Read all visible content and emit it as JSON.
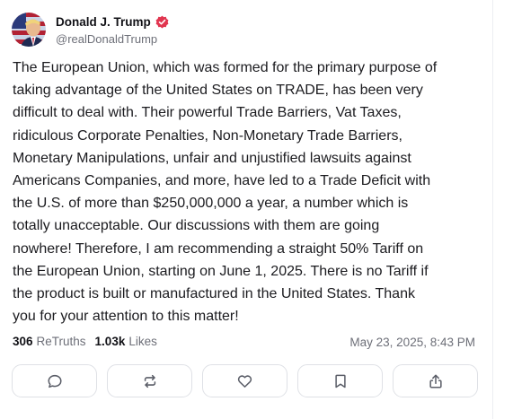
{
  "author": {
    "display_name": "Donald J. Trump",
    "handle": "@realDonaldTrump",
    "verified": true
  },
  "post": {
    "text": "The European Union, which was formed for the primary purpose of\ntaking advantage of the United States on TRADE, has been very\ndifficult to deal with. Their powerful Trade Barriers, Vat Taxes,\nridiculous Corporate Penalties, Non-Monetary Trade Barriers,\nMonetary Manipulations, unfair and unjustified lawsuits against\nAmericans Companies, and more, have led to a Trade Deficit with\nthe U.S. of more than $250,000,000 a year, a number which is\ntotally unacceptable. Our discussions with them are going\nnowhere! Therefore, I am recommending a straight 50% Tariff on\nthe European Union, starting on June 1, 2025. There is no Tariff if\nthe product is built or manufactured in the United States. Thank\nyou for your attention to this matter!"
  },
  "stats": {
    "retruths_count": "306",
    "retruths_label": "ReTruths",
    "likes_count": "1.03k",
    "likes_label": "Likes"
  },
  "timestamp": "May 23, 2025, 8:43 PM",
  "actions": [
    {
      "name": "reply",
      "icon": "speech-bubble-icon"
    },
    {
      "name": "retruth",
      "icon": "repost-arrows-icon"
    },
    {
      "name": "like",
      "icon": "heart-icon"
    },
    {
      "name": "bookmark",
      "icon": "bookmark-icon"
    },
    {
      "name": "share",
      "icon": "share-icon"
    }
  ],
  "colors": {
    "verified_badge": "#e1354f",
    "muted_text": "#6d6f78",
    "icon_stroke": "#5b5e68",
    "button_border": "#dfe1e6"
  }
}
